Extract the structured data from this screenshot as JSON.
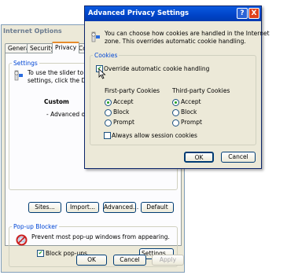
{
  "internet_options": {
    "title": "Internet Options",
    "tabs": [
      "General",
      "Security",
      "Privacy",
      "Co"
    ],
    "active_tab": "Privacy",
    "settings": {
      "legend": "Settings",
      "desc_line1": "To use the slider to se",
      "desc_line2": "settings, click the Def",
      "level": "Custom",
      "level_desc": "- Advanced or imp",
      "buttons": [
        "Sites...",
        "Import...",
        "Advanced...",
        "Default"
      ]
    },
    "popup_blocker": {
      "legend": "Pop-up Blocker",
      "desc": "Prevent most pop-up windows from appearing.",
      "checkbox_label": "Block pop-ups",
      "checked": true,
      "settings_button": "Settings..."
    },
    "footer": {
      "ok": "OK",
      "cancel": "Cancel",
      "apply": "Apply"
    }
  },
  "advanced_privacy": {
    "title": "Advanced Privacy Settings",
    "help_glyph": "?",
    "close_glyph": "X",
    "description_line1": "You can choose how cookies are handled in the Internet",
    "description_line2": "zone. This overrides automatic cookie handling.",
    "cookies": {
      "legend": "Cookies",
      "override_label": "Override automatic cookie handling",
      "override_checked": true,
      "first_party": {
        "label": "First-party Cookies",
        "options": [
          "Accept",
          "Block",
          "Prompt"
        ],
        "selected": "Accept"
      },
      "third_party": {
        "label": "Third-party Cookies",
        "options": [
          "Accept",
          "Block",
          "Prompt"
        ],
        "selected": "Accept"
      },
      "session_label": "Always allow session cookies",
      "session_checked": false
    },
    "ok": "OK",
    "cancel": "Cancel"
  }
}
